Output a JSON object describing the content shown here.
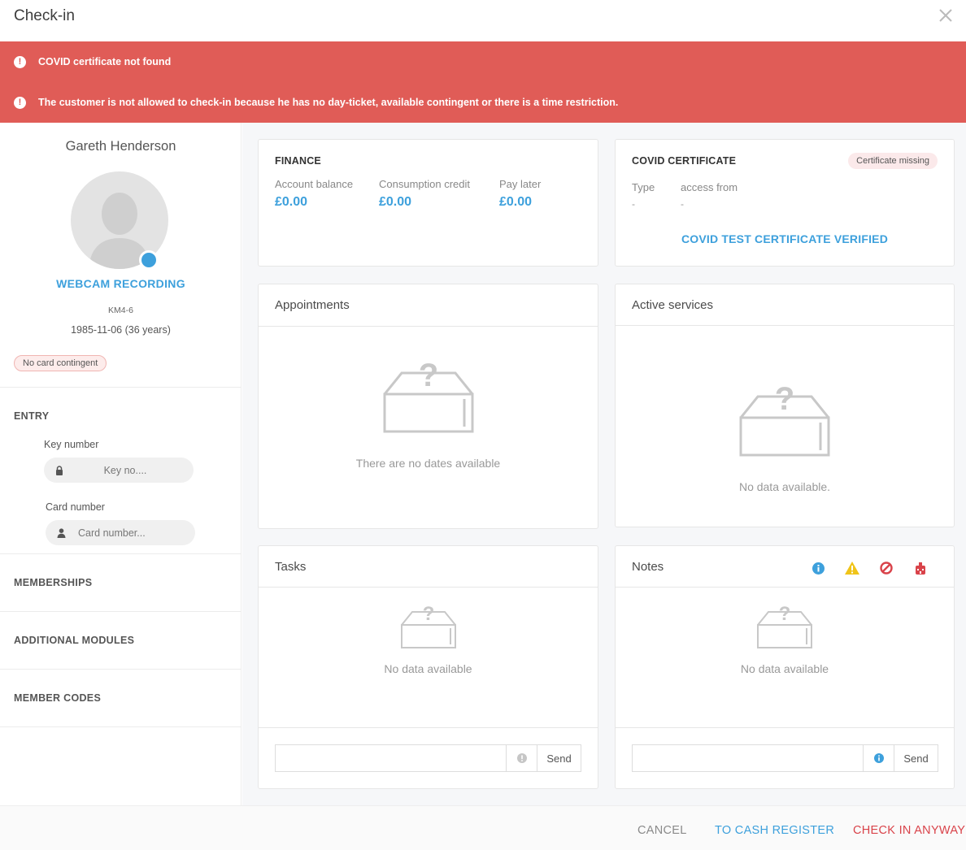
{
  "header": {
    "title": "Check-in",
    "close_icon": "close-icon"
  },
  "alerts": [
    {
      "icon": "exclamation-icon",
      "text": "COVID certificate not found"
    },
    {
      "icon": "exclamation-icon",
      "text": "The customer is not allowed to check-in because he has no day-ticket, available contingent or there is a time restriction."
    }
  ],
  "customer": {
    "name": "Gareth Henderson",
    "webcam_label": "WEBCAM RECORDING",
    "id": "KM4-6",
    "dob": "1985-11-06 (36 years)",
    "contingent_badge": "No card contingent"
  },
  "entry": {
    "title": "ENTRY",
    "key_label": "Key number",
    "key_placeholder": "Key no....",
    "card_label": "Card number",
    "card_placeholder": "Card number..."
  },
  "sidebar_sections": [
    "MEMBERSHIPS",
    "ADDITIONAL MODULES",
    "MEMBER CODES"
  ],
  "finance": {
    "title": "FINANCE",
    "items": [
      {
        "label": "Account balance",
        "value": "£0.00"
      },
      {
        "label": "Consumption credit",
        "value": "£0.00"
      },
      {
        "label": "Pay later",
        "value": "£0.00"
      }
    ]
  },
  "covid": {
    "title": "COVID CERTIFICATE",
    "badge": "Certificate missing",
    "type_label": "Type",
    "type_value": "-",
    "access_label": "access from",
    "access_value": "-",
    "link": "COVID TEST CERTIFICATE VERIFIED"
  },
  "appointments": {
    "title": "Appointments",
    "empty": "There are no dates available"
  },
  "active_services": {
    "title": "Active services",
    "empty": "No data available."
  },
  "tasks": {
    "title": "Tasks",
    "empty": "No data available",
    "send": "Send"
  },
  "notes": {
    "title": "Notes",
    "empty": "No data available",
    "send": "Send",
    "icons": [
      "info-icon",
      "warning-icon",
      "ban-icon",
      "alarm-icon"
    ]
  },
  "footer": {
    "cancel": "CANCEL",
    "cash_register": "TO CASH REGISTER",
    "check_in": "CHECK IN ANYWAY"
  },
  "colors": {
    "alert_bg": "#e05c57",
    "accent": "#3da0dc",
    "danger": "#d9434a",
    "warning": "#f0c419"
  }
}
